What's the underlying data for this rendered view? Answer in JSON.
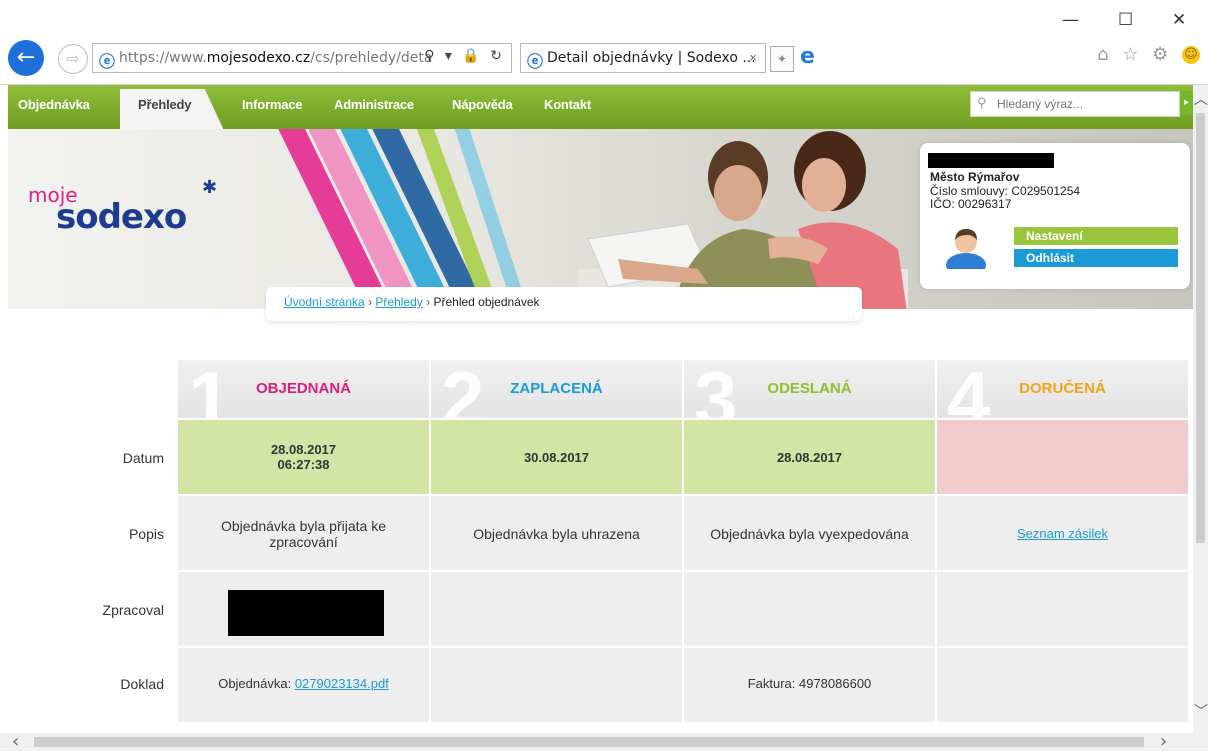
{
  "browser": {
    "url_prefix": "https://www.",
    "url_domain": "mojesodexo.cz",
    "url_path": "/cs/prehledy/deta",
    "tab_title": "Detail objednávky | Sodexo ...",
    "tab_close": "×",
    "window_min": "—",
    "window_max": "☐",
    "window_close": "✕",
    "back_icon": "←",
    "forward_icon": "⇨",
    "addr_tools": "⚲ ▾ 🔒 ↻",
    "right_tools": "⌂ ☆ ⚙"
  },
  "menu": {
    "items": [
      {
        "label": "Objednávka"
      },
      {
        "label": "Přehledy"
      },
      {
        "label": "Informace"
      },
      {
        "label": "Administrace"
      },
      {
        "label": "Nápověda"
      },
      {
        "label": "Kontakt"
      }
    ],
    "search_placeholder": "Hledaný výraz..."
  },
  "logo": {
    "moje": "moje",
    "sodexo": "sodexo",
    "star": "✱"
  },
  "user": {
    "org": "Město Rýmařov",
    "contract": "Číslo smlouvy: C029501254",
    "ico": "IČO: 00296317",
    "settings_label": "Nastavení",
    "logout_label": "Odhlásit"
  },
  "breadcrumb": {
    "home": "Úvodní stránka",
    "sep": "›",
    "overviews": "Přehledy",
    "current": "Přehled objednávek"
  },
  "status": {
    "steps": [
      {
        "num": "1",
        "label": "OBJEDNANÁ",
        "color": "#d6207f"
      },
      {
        "num": "2",
        "label": "ZAPLACENÁ",
        "color": "#1a9ad6"
      },
      {
        "num": "3",
        "label": "ODESLANÁ",
        "color": "#8dbf2e"
      },
      {
        "num": "4",
        "label": "DORUČENÁ",
        "color": "#f2a31b"
      }
    ],
    "rows": {
      "datum": {
        "label": "Datum",
        "c1_date": "28.08.2017",
        "c1_time": "06:27:38",
        "c2": "30.08.2017",
        "c3": "28.08.2017",
        "c4": ""
      },
      "popis": {
        "label": "Popis",
        "c1": "Objednávka byla přijata ke zpracování",
        "c2": "Objednávka byla uhrazena",
        "c3": "Objednávka byla vyexpedována",
        "c4_link": "Seznam zásilek"
      },
      "zpracoval": {
        "label": "Zpracoval"
      },
      "doklad": {
        "label": "Doklad",
        "c1_prefix": "Objednávka: ",
        "c1_link": "0279023134.pdf",
        "c3": "Faktura: 4978086600"
      }
    }
  },
  "colors": {
    "menu_green": "#7aad2a",
    "date_green": "#d2e5a5",
    "date_pink": "#f2cccc",
    "row_grey": "#eeeeee",
    "link_blue": "#1a9ad6"
  },
  "scroll": {
    "up": "︿",
    "down": "﹀",
    "left": "‹",
    "right": "›"
  }
}
